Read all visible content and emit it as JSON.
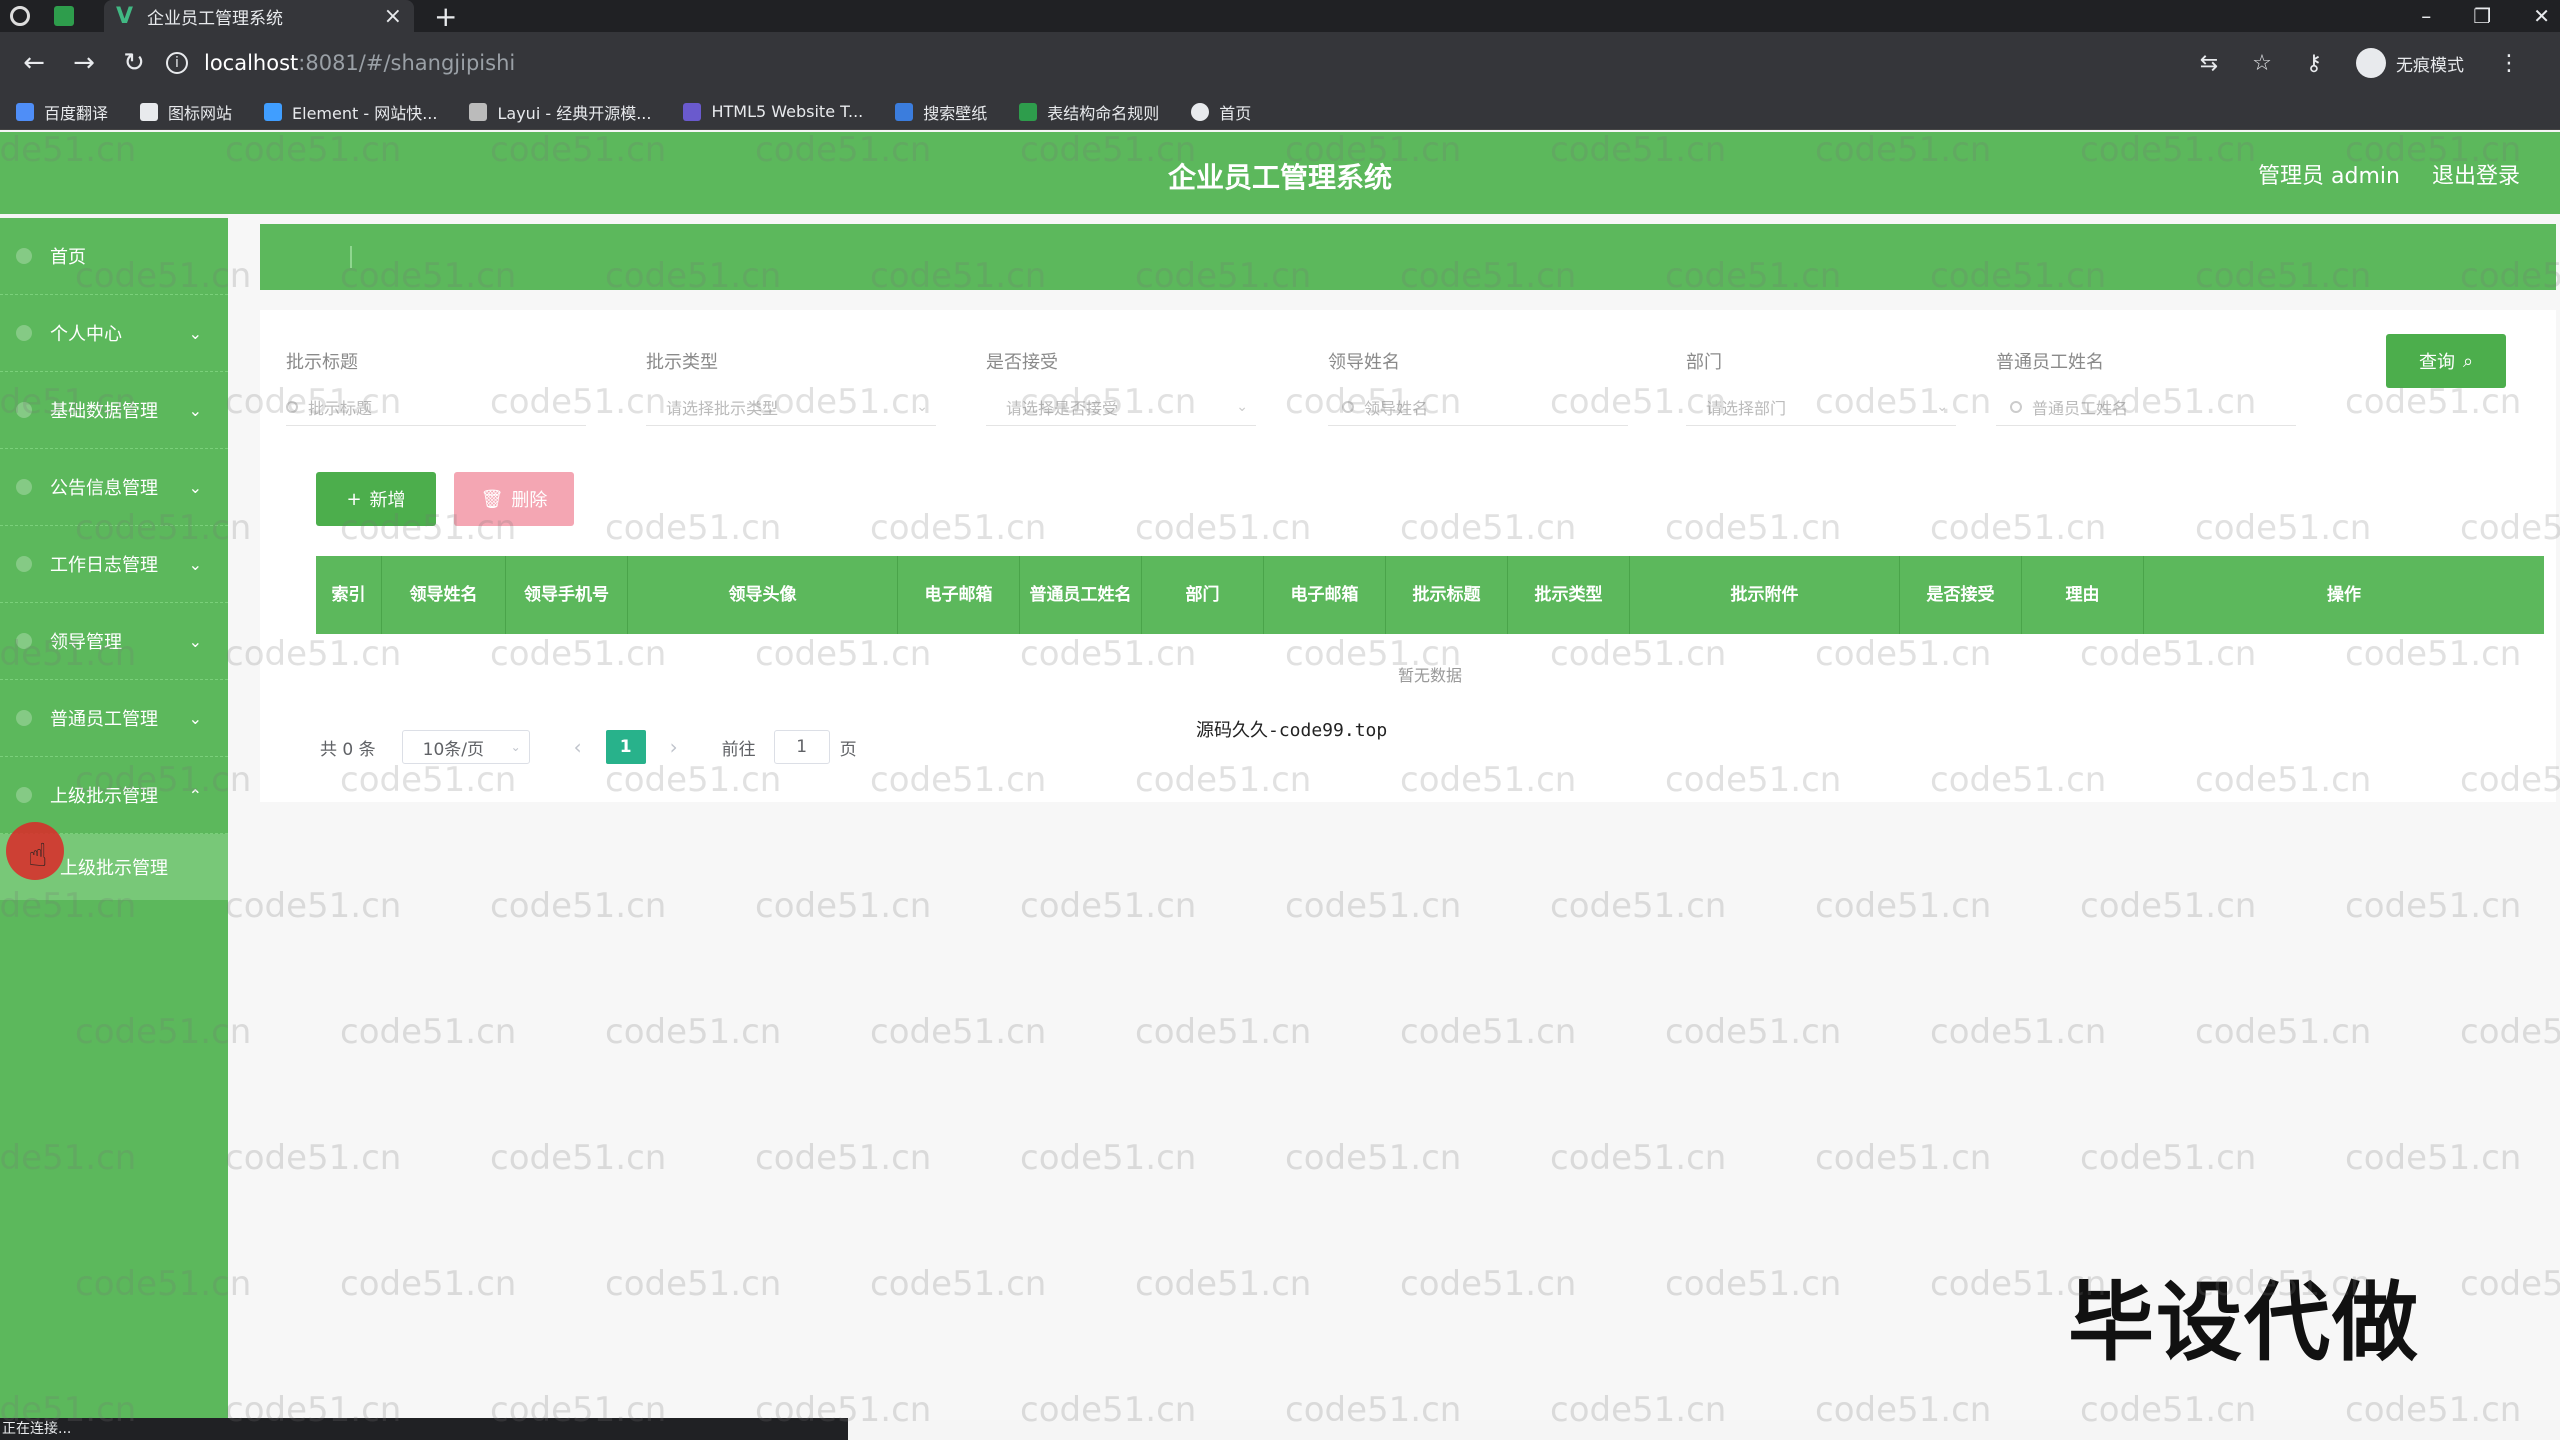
{
  "browser": {
    "tab_title": "企业员工管理系统",
    "tab_close": "×",
    "new_tab": "+",
    "url_host": "localhost",
    "url_path": ":8081/#/shangjipishi",
    "incognito_label": "无痕模式",
    "bookmarks": [
      "百度翻译",
      "图标网站",
      "Element - 网站快...",
      "Layui - 经典开源模...",
      "HTML5 Website T...",
      "搜索壁纸",
      "表结构命名规则",
      "首页"
    ],
    "status_text": "正在连接..."
  },
  "header": {
    "title": "企业员工管理系统",
    "admin_label": "管理员 admin",
    "logout_label": "退出登录"
  },
  "sidebar": {
    "items": [
      {
        "label": "首页",
        "chevron": ""
      },
      {
        "label": "个人中心",
        "chevron": "⌄"
      },
      {
        "label": "基础数据管理",
        "chevron": "⌄"
      },
      {
        "label": "公告信息管理",
        "chevron": "⌄"
      },
      {
        "label": "工作日志管理",
        "chevron": "⌄"
      },
      {
        "label": "领导管理",
        "chevron": "⌄"
      },
      {
        "label": "普通员工管理",
        "chevron": "⌄"
      },
      {
        "label": "上级批示管理",
        "chevron": "⌃"
      }
    ],
    "submenu": {
      "label": "上级批示管理"
    }
  },
  "filters": [
    {
      "label": "批示标题",
      "placeholder": "批示标题"
    },
    {
      "label": "批示类型",
      "placeholder": "请选择批示类型"
    },
    {
      "label": "是否接受",
      "placeholder": "请选择是否接受"
    },
    {
      "label": "领导姓名",
      "placeholder": "领导姓名"
    },
    {
      "label": "部门",
      "placeholder": "请选择部门"
    },
    {
      "label": "普通员工姓名",
      "placeholder": "普通员工姓名"
    }
  ],
  "buttons": {
    "query": "查询",
    "add": "新增",
    "delete": "删除"
  },
  "table": {
    "columns": [
      "索引",
      "领导姓名",
      "领导手机号",
      "领导头像",
      "电子邮箱",
      "普通员工姓名",
      "部门",
      "电子邮箱",
      "批示标题",
      "批示类型",
      "批示附件",
      "是否接受",
      "理由",
      "操作"
    ],
    "empty_text": "暂无数据"
  },
  "pagination": {
    "total_label": "共 0 条",
    "page_size": "10条/页",
    "current_page": "1",
    "goto_prefix": "前往",
    "goto_value": "1",
    "goto_suffix": "页"
  },
  "overlays": {
    "center_text": "源码久久-code99.top",
    "big_text": "毕设代做",
    "watermark": "code51.cn"
  },
  "colors": {
    "primary_green": "#5cb85c",
    "button_green": "#4cae4c",
    "delete_pink": "#f4a6b3",
    "active_page": "#28b28b"
  }
}
